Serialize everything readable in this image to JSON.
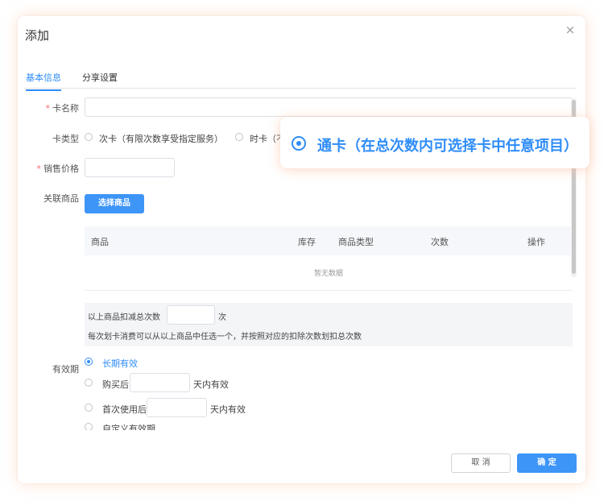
{
  "dialog": {
    "title": "添加",
    "close_symbol": "×"
  },
  "tabs": [
    {
      "label": "基本信息",
      "active": true
    },
    {
      "label": "分享设置",
      "active": false
    }
  ],
  "form": {
    "card_name": {
      "label": "卡名称",
      "required": true,
      "value": ""
    },
    "card_type": {
      "label": "卡类型",
      "options": [
        "次卡（有限次数享受指定服务）",
        "时卡（不"
      ]
    },
    "price": {
      "label": "销售价格",
      "required": true,
      "value": ""
    },
    "products": {
      "label": "关联商品",
      "button": "选择商品",
      "columns": [
        "商品",
        "库存",
        "商品类型",
        "次数",
        "操作"
      ],
      "empty_text": "暂无数据"
    },
    "deduct": {
      "prefix": "以上商品扣减总次数",
      "suffix": "次",
      "hint": "每次划卡消费可以从以上商品中任选一个，并按照对应的扣除次数划扣总次数"
    },
    "validity": {
      "label": "有效期",
      "options": [
        {
          "label": "长期有效",
          "checked": true
        },
        {
          "prefix": "购买后",
          "suffix": "天内有效",
          "checked": false
        },
        {
          "prefix": "首次使用后",
          "suffix": "天内有效",
          "checked": false
        },
        {
          "label": "自定义有效期",
          "checked": false
        }
      ]
    }
  },
  "footer": {
    "cancel": "取 消",
    "confirm": "确 定"
  },
  "callout": {
    "text": "通卡（在总次数内可选择卡中任意项目）"
  },
  "colors": {
    "accent": "#2f8df8",
    "primary_button": "#3d95f7",
    "required": "#f56c6c"
  }
}
